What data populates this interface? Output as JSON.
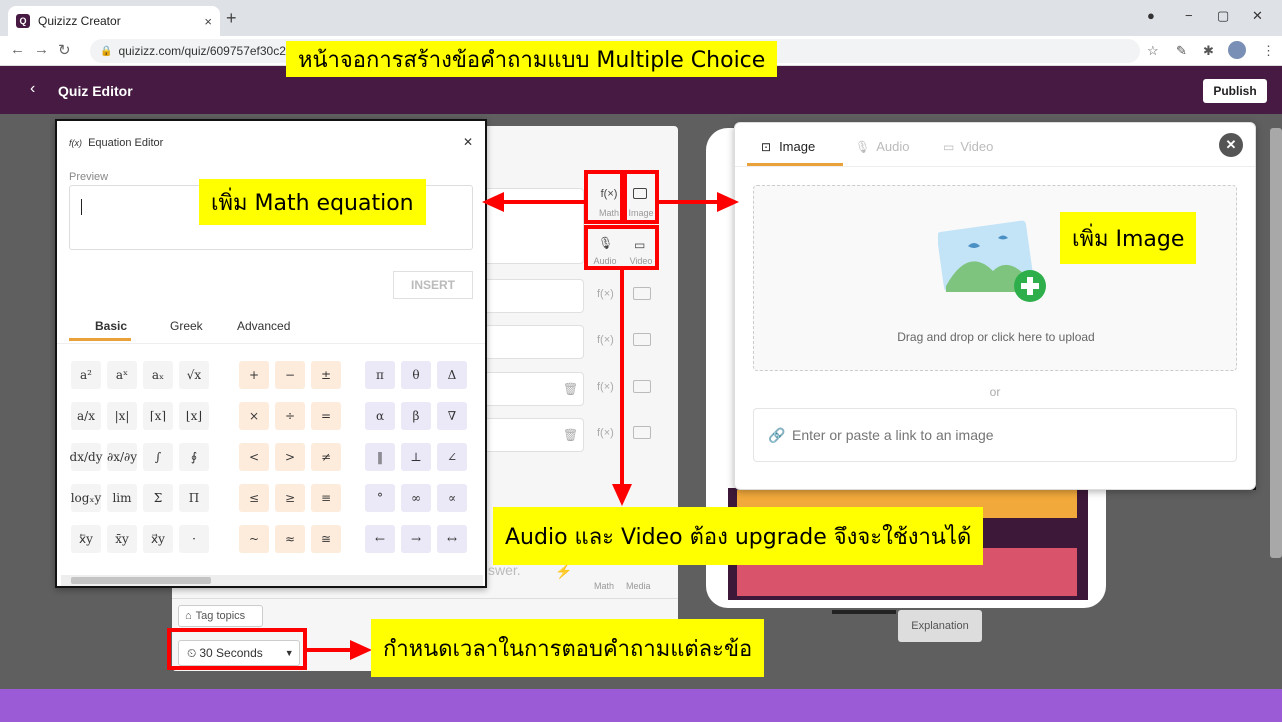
{
  "browser": {
    "tab_title": "Quizizz Creator",
    "favicon_letter": "Q",
    "url": "quizizz.com/quiz/609757ef30c2"
  },
  "header": {
    "title": "Quiz Editor",
    "back_icon": "chevron-left-icon",
    "publish_label": "Publish"
  },
  "equation_editor": {
    "title": "Equation Editor",
    "title_icon": "f(x)",
    "preview_label": "Preview",
    "insert_label": "INSERT",
    "tabs": [
      "Basic",
      "Greek",
      "Advanced"
    ],
    "active_tab": "Basic",
    "keys": {
      "group1": [
        "a²",
        "aˣ",
        "aₓ",
        "√x",
        "a/x",
        "|x|",
        "⌈x⌉",
        "⌊x⌋",
        "dx/dy",
        "∂x/∂y",
        "∫",
        "∮",
        "logₓy",
        "lim",
        "Σ",
        "Π",
        "x⃖y",
        "x̄y",
        "x⃗y",
        "·"
      ],
      "group2": [
        "+",
        "−",
        "±",
        "×",
        "÷",
        "=",
        "<",
        ">",
        "≠",
        "≤",
        "≥",
        "≡",
        "~",
        "≈",
        "≅"
      ],
      "group3": [
        "π",
        "θ",
        "Δ",
        "α",
        "β",
        "∇",
        "‖",
        "⊥",
        "∠",
        "°",
        "∞",
        "∝",
        "←",
        "→",
        "↔"
      ]
    }
  },
  "question_editor": {
    "side_tools": [
      {
        "label": "Math",
        "icon": "f(x)"
      },
      {
        "label": "Image",
        "icon": "image-icon"
      },
      {
        "label": "Audio",
        "icon": "microphone-icon"
      },
      {
        "label": "Video",
        "icon": "video-icon"
      }
    ],
    "answer_placeholder_fragment": "swer.",
    "bottom_tools": [
      "Math",
      "Media"
    ],
    "tag_topics_label": "Tag topics",
    "timer_value": "30 Seconds"
  },
  "image_panel": {
    "tabs": [
      "Image",
      "Audio",
      "Video"
    ],
    "active_tab": "Image",
    "drop_text": "Drag and drop or click here to upload",
    "or_text": "or",
    "link_placeholder": "Enter or paste a link to an image"
  },
  "explanation_label": "Explanation",
  "annotations": {
    "title": "หน้าจอการสร้างข้อคำถามแบบ Multiple Choice",
    "math": "เพิ่ม Math equation",
    "image": "เพิ่ม Image",
    "audio_video": "Audio และ Video ต้อง upgrade จึงจะใช้งานได้",
    "timer": "กำหนดเวลาในการตอบคำถามแต่ละข้อ"
  },
  "colors": {
    "header": "#461a42",
    "accent": "#e9a13b",
    "bottom_bar": "#9b5bd6",
    "annotation_bg": "#ffff00",
    "annotation_line": "#ff0000"
  }
}
